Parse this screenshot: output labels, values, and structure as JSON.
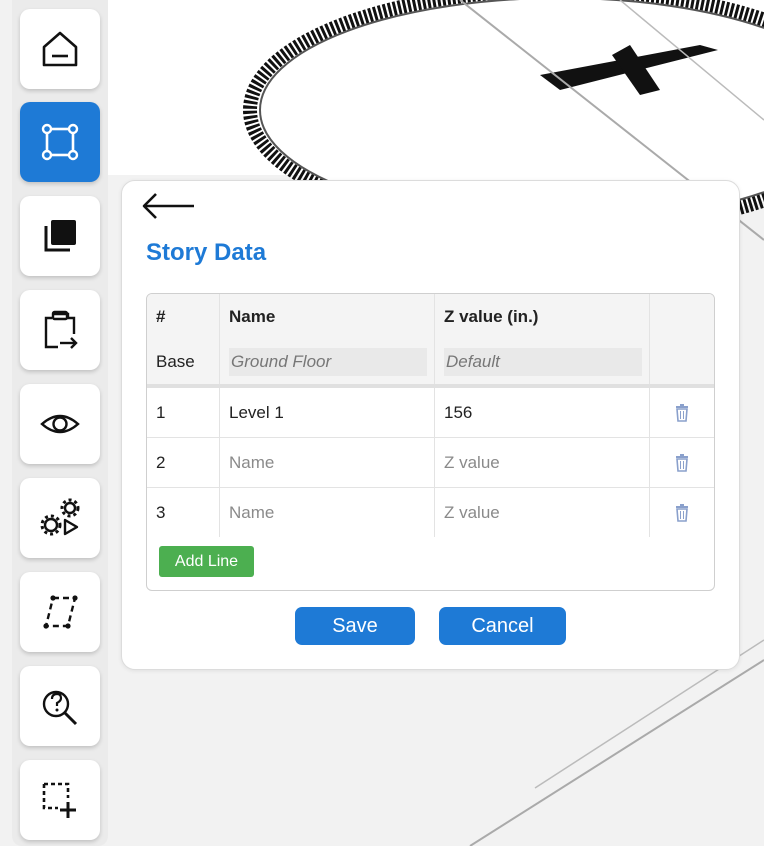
{
  "sidebar": {
    "tools": [
      {
        "icon": "home-icon"
      },
      {
        "icon": "polygon-select-icon",
        "active": true
      },
      {
        "icon": "layers-icon"
      },
      {
        "icon": "clipboard-export-icon"
      },
      {
        "icon": "eye-icon"
      },
      {
        "icon": "gears-play-icon"
      },
      {
        "icon": "parallelogram-icon"
      },
      {
        "icon": "question-search-icon"
      },
      {
        "icon": "add-selection-icon"
      }
    ],
    "active_color": "#1e7ad6"
  },
  "dialog": {
    "title": "Story Data",
    "back_icon": "arrow-left-icon",
    "table": {
      "headers": [
        "#",
        "Name",
        "Z value (in.)",
        ""
      ],
      "base_row": {
        "label": "Base",
        "name_placeholder": "Ground Floor",
        "z_placeholder": "Default"
      },
      "rows": [
        {
          "index": "1",
          "name": "Level 1",
          "z": "156",
          "name_placeholder": "Name",
          "z_placeholder": "Z value"
        },
        {
          "index": "2",
          "name": "",
          "z": "",
          "name_placeholder": "Name",
          "z_placeholder": "Z value"
        },
        {
          "index": "3",
          "name": "",
          "z": "",
          "name_placeholder": "Name",
          "z_placeholder": "Z value"
        }
      ],
      "delete_icon": "trash-icon"
    },
    "add_line_label": "Add Line",
    "save_label": "Save",
    "cancel_label": "Cancel"
  },
  "colors": {
    "primary": "#1e7ad6",
    "add_line": "#4caf50",
    "trash": "#8aa0cc"
  }
}
